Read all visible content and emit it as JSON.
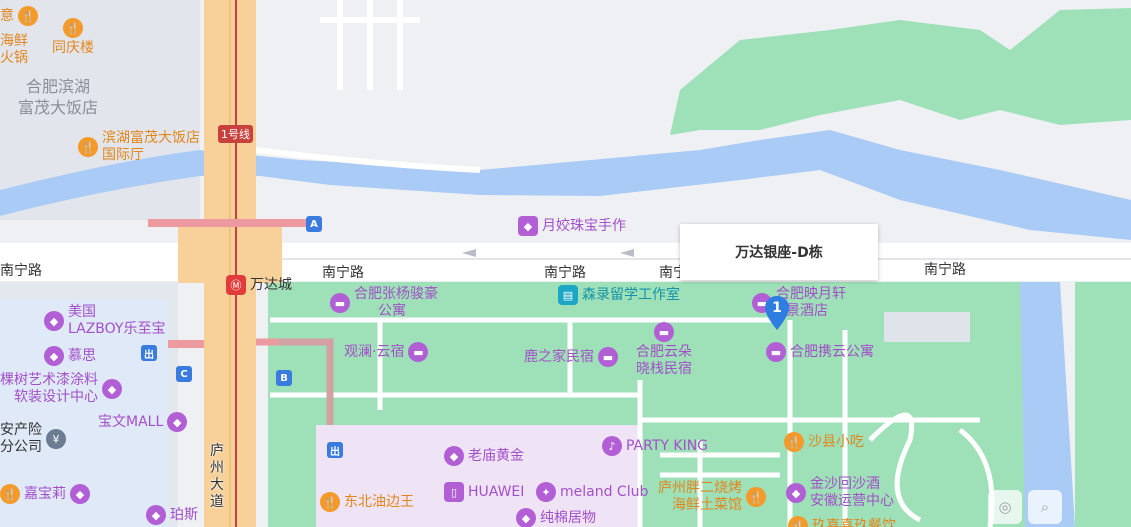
{
  "map": {
    "callout": {
      "title": "万达银座-D栋"
    },
    "pin": {
      "number": "1"
    },
    "metro": {
      "line": "1号线",
      "station": "万达城"
    },
    "roads": {
      "nanning_1": "南宁路",
      "nanning_2": "南宁路",
      "nanning_3": "南宁路",
      "nanning_4": "南宁",
      "nanning_5": "南宁路",
      "luzhou_1": "庐",
      "luzhou_2": "州",
      "luzhou_3": "大",
      "luzhou_4": "道"
    },
    "areas": {
      "binhu_1": "合肥滨湖",
      "binhu_2": "富茂大饭店"
    },
    "exits": {
      "a": "A",
      "b": "B",
      "c": "C",
      "out1": "出",
      "out2": "出"
    },
    "pois": {
      "hotpot_1": "海鲜",
      "hotpot_2": "火锅",
      "top_left_fragment": "意",
      "tongqing": "同庆楼",
      "binhu_hall_1": "滨湖富茂大饭店",
      "binhu_hall_2": "国际厅",
      "yuejiao": "月姣珠宝手作",
      "zhangyang_1": "合肥张杨骏豪",
      "zhangyang_2": "公寓",
      "senlu": "森录留学工作室",
      "yingyue_1": "合肥映月轩",
      "yingyue_2": "景酒店",
      "guanlan": "观澜·云宿",
      "luzhijia": "鹿之家民宿",
      "yunduo_1": "合肥云朵",
      "yunduo_2": "晓栈民宿",
      "xieyun": "合肥携云公寓",
      "lazboy_1": "美国",
      "lazboy_2": "LAZBOY乐至宝",
      "musi": "慕思",
      "keshu_1": "棵树艺术漆涂料",
      "keshu_2": "软装设计中心",
      "baowen": "宝文MALL",
      "insurance_1": "安产险",
      "insurance_2": "分公司",
      "jiabaoli": "嘉宝莉",
      "pasi": "珀斯",
      "laomiao": "老庙黄金",
      "partyking": "PARTY KING",
      "huawei": "HUAWEI",
      "meland": "meland Club",
      "chunmian": "纯棉居物",
      "dongbei": "东北油边王",
      "shaxian": "沙县小吃",
      "bbq_1": "庐州胖二烧烤",
      "bbq_2": "海鲜土菜馆",
      "jinsha_1": "金沙回沙酒",
      "jinsha_2": "安徽运营中心",
      "bottom_fragment": "玖喜喜玖餐饮"
    },
    "icons": {
      "food": "restaurant-icon",
      "hotel": "hotel-icon",
      "shop": "shopping-bag-icon",
      "metro": "metro-icon"
    },
    "colors": {
      "water": "#a9cbf5",
      "park": "#9ee0b8",
      "road": "#ffffff",
      "highway": "#f7d199",
      "metro": "#c8413d",
      "pin": "#2f7de0"
    }
  }
}
